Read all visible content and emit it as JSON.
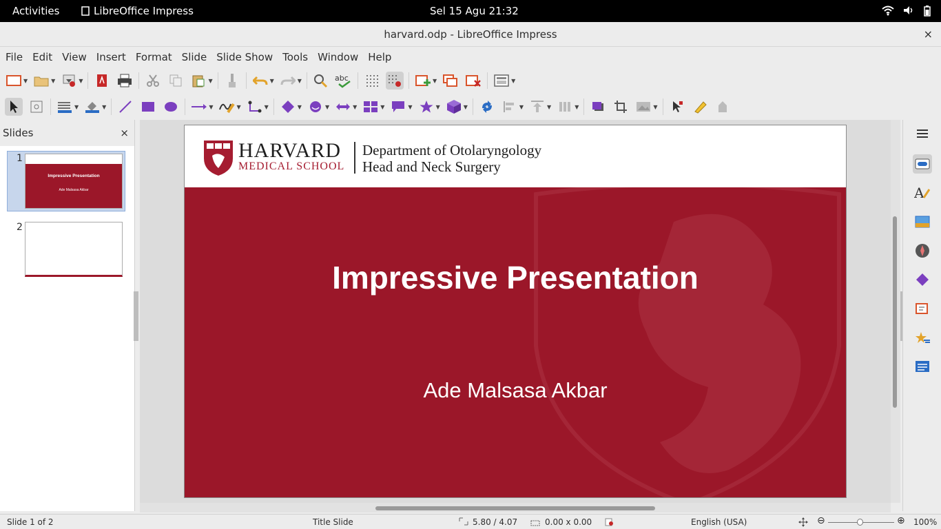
{
  "topbar": {
    "activities": "Activities",
    "app": "LibreOffice Impress",
    "clock": "Sel 15 Agu  21:32"
  },
  "window": {
    "title": "harvard.odp - LibreOffice Impress",
    "close": "×"
  },
  "menu": [
    "File",
    "Edit",
    "View",
    "Insert",
    "Format",
    "Slide",
    "Slide Show",
    "Tools",
    "Window",
    "Help"
  ],
  "slides_panel": {
    "title": "Slides",
    "close": "×",
    "thumbs": [
      {
        "num": "1",
        "title": "Impressive Presentation",
        "author": "Ade Malsasa Akbar"
      },
      {
        "num": "2"
      }
    ]
  },
  "slide": {
    "logo_main": "HARVARD",
    "logo_sub": "MEDICAL SCHOOL",
    "dept_line1": "Department of Otolaryngology",
    "dept_line2": "Head and Neck Surgery",
    "title": "Impressive Presentation",
    "author": "Ade Malsasa Akbar"
  },
  "status": {
    "slide": "Slide 1 of 2",
    "layout": "Title Slide",
    "position": "5.80 / 4.07",
    "size": "0.00 x 0.00",
    "language": "English (USA)",
    "zoom": "100%"
  },
  "colors": {
    "harvard_red": "#9b1729",
    "menu_bg": "#ececec"
  }
}
